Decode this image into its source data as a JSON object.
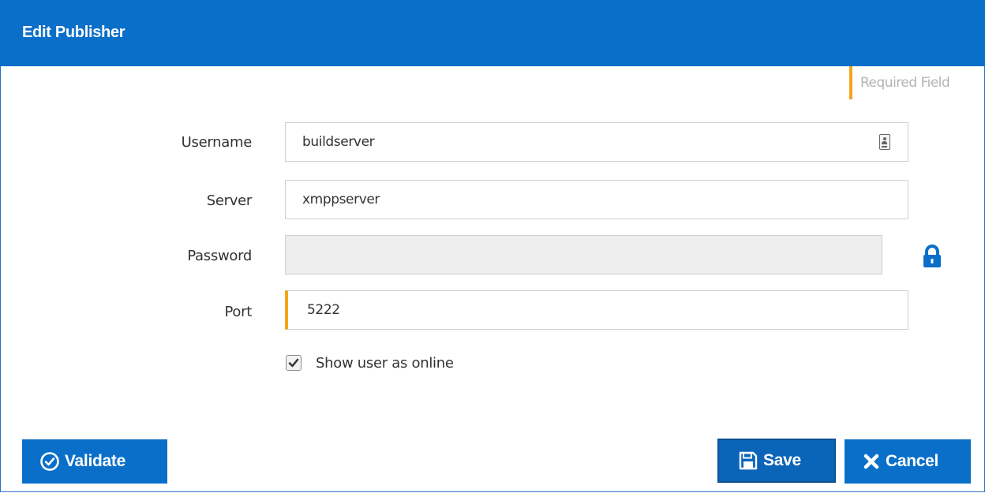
{
  "dialog": {
    "title": "Edit Publisher"
  },
  "legend": {
    "required_text": "Required Field",
    "required_color": "#f4a51c"
  },
  "fields": {
    "username": {
      "label": "Username",
      "value": "buildserver",
      "icon": "contact-card-icon"
    },
    "server": {
      "label": "Server",
      "value": "xmppserver"
    },
    "password": {
      "label": "Password",
      "value": "",
      "disabled": true,
      "icon": "lock-icon"
    },
    "port": {
      "label": "Port",
      "value": "5222",
      "required": true
    }
  },
  "options": {
    "show_online_label": "Show user as online",
    "show_online_checked": true
  },
  "buttons": {
    "validate_label": "Validate",
    "save_label": "Save",
    "cancel_label": "Cancel"
  },
  "colors": {
    "accent": "#0a6fc9",
    "required": "#f4a51c"
  }
}
